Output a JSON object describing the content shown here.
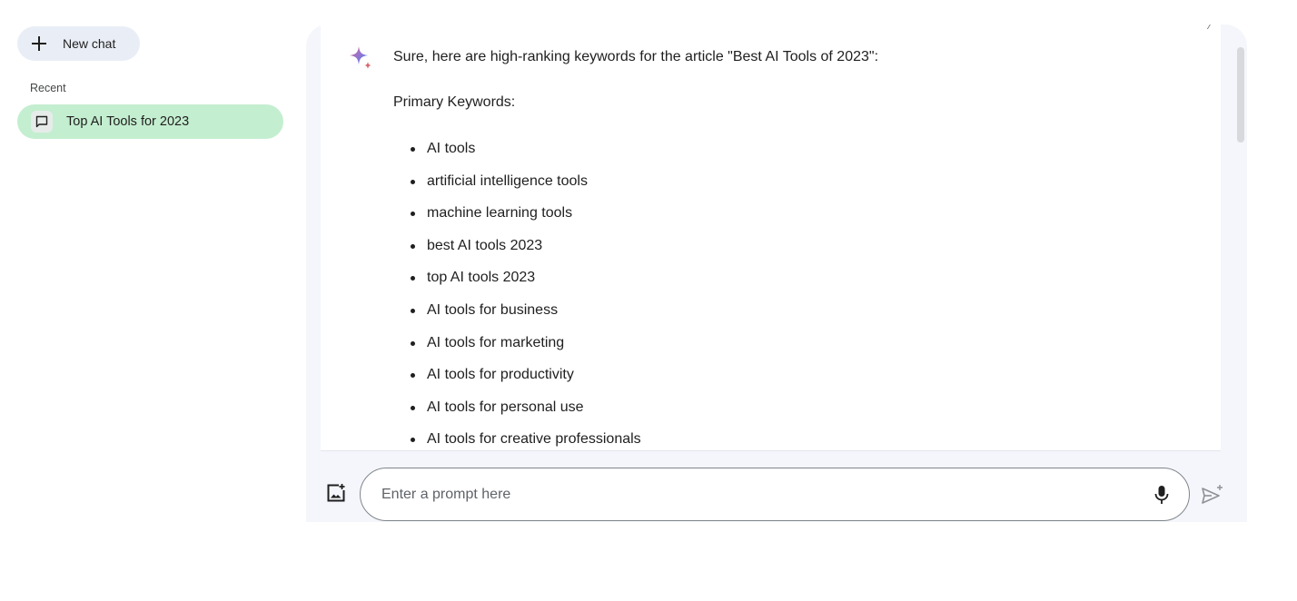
{
  "sidebar": {
    "new_chat_label": "New chat",
    "recent_heading": "Recent",
    "recent_items": [
      {
        "label": "Top AI Tools for 2023",
        "selected": true
      }
    ]
  },
  "conversation": {
    "response": {
      "intro": "Sure, here are high-ranking keywords for the article \"Best AI Tools of 2023\":",
      "heading": "Primary Keywords:",
      "keywords": [
        "AI tools",
        "artificial intelligence tools",
        "machine learning tools",
        "best AI tools 2023",
        "top AI tools 2023",
        "AI tools for business",
        "AI tools for marketing",
        "AI tools for productivity",
        "AI tools for personal use",
        "AI tools for creative professionals"
      ]
    }
  },
  "input": {
    "placeholder": "Enter a prompt here",
    "value": ""
  },
  "icons": {
    "new_chat": "plus-icon",
    "recent_item": "chat-bubble-icon",
    "assistant": "sparkle-icon",
    "upload": "image-upload-icon",
    "mic": "microphone-icon",
    "send": "send-icon"
  },
  "colors": {
    "selected_item_bg": "#c4eed0",
    "new_chat_bg": "#e9eef6",
    "panel_bg": "#f4f6fb",
    "sparkle_gradient": [
      "#4285f4",
      "#9b72cb",
      "#d96570"
    ]
  }
}
